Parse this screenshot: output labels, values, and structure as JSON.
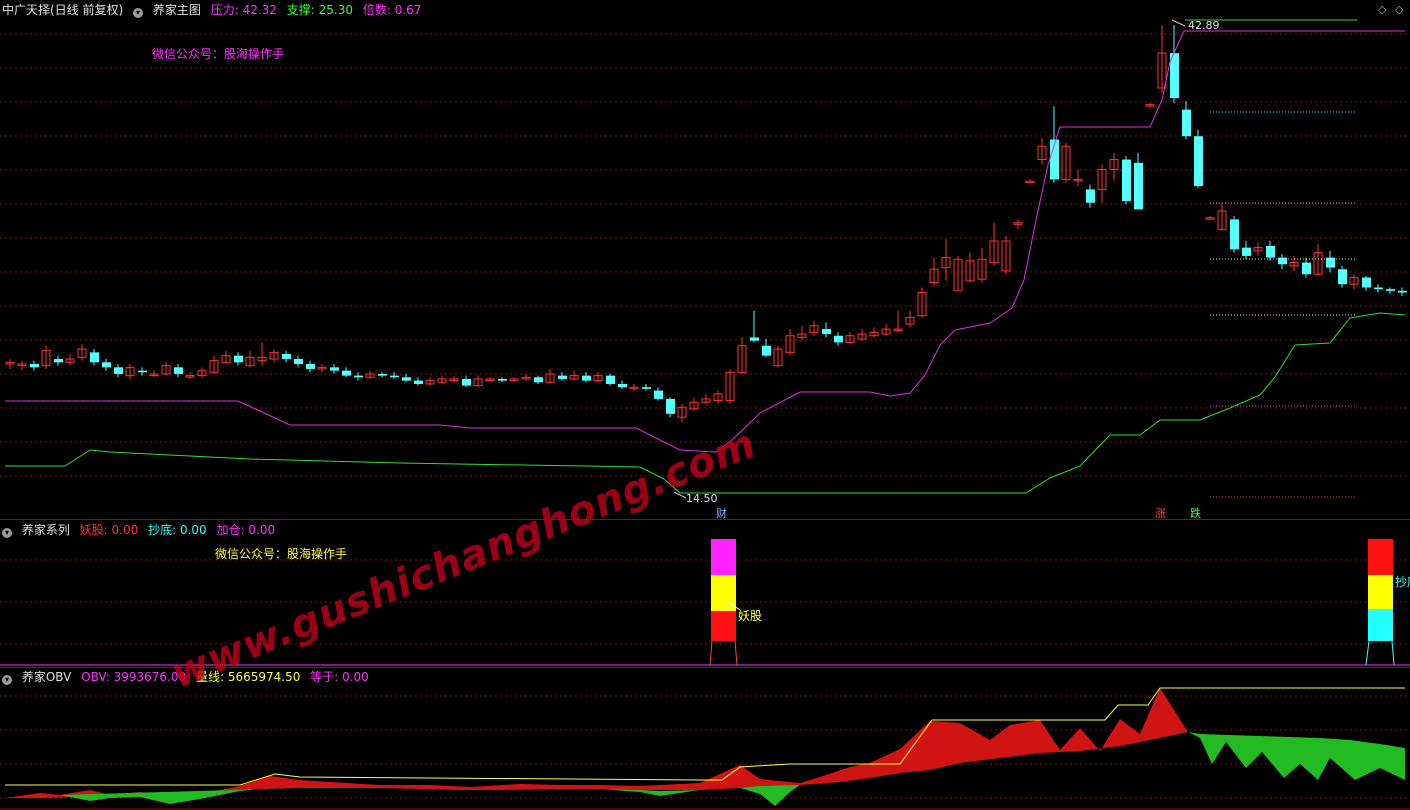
{
  "main_panel": {
    "stock_name": "中广天择(日线 前复权)",
    "indicator_name": "养家主图",
    "pressure_label": "压力:",
    "pressure_value": "42.32",
    "support_label": "支撑:",
    "support_value": "25.30",
    "multiple_label": "倍数:",
    "multiple_value": "0.67",
    "wechat_note": "微信公众号：股海操作手",
    "high_price_label": "42.89",
    "low_price_label": "14.50",
    "tag_cai": "财",
    "tag_zhang": "涨",
    "tag_die": "跌",
    "colors": {
      "up": "#ff3333",
      "down": "#55ffff",
      "pressure_line": "#dd33dd",
      "support_line": "#33dd33",
      "grid": "#8a1010"
    }
  },
  "system_panel": {
    "indicator_name": "养家系列",
    "yaogu_label": "妖股:",
    "yaogu_value": "0.00",
    "chaodi_label": "抄底:",
    "chaodi_value": "0.00",
    "jiacang_label": "加仓:",
    "jiacang_value": "0.00",
    "wechat_note": "微信公众号：股海操作手",
    "signal_yaogu": "妖股",
    "signal_chaodi": "抄底"
  },
  "obv_panel": {
    "indicator_name": "养家OBV",
    "obv_label": "OBV:",
    "obv_value": "3993676.00",
    "volume_line_label": "量线:",
    "volume_line_value": "5665974.50",
    "equal_label": "等于:",
    "equal_value": "0.00"
  },
  "watermark": "www.gushichanghong.com",
  "chart_data": {
    "type": "candlestick",
    "price_range": [
      14.5,
      42.89
    ],
    "pressure_level": 42.32,
    "support_level": 25.3
  }
}
